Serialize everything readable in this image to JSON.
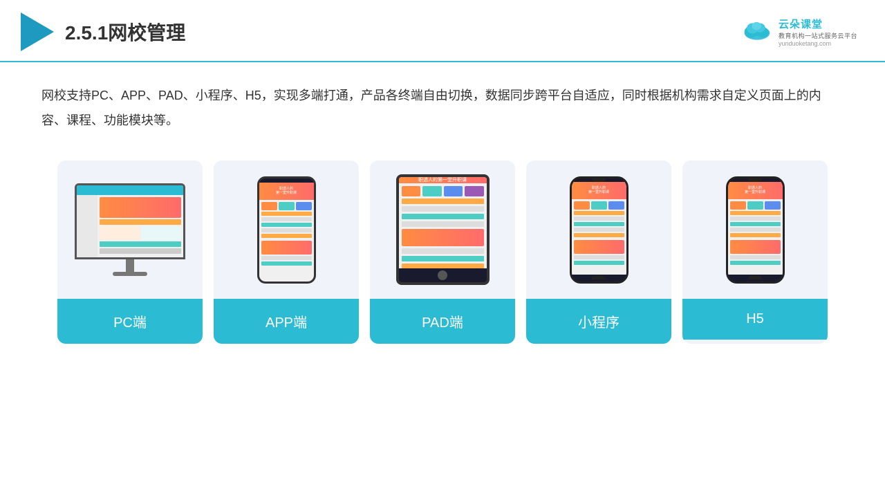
{
  "header": {
    "title": "2.5.1网校管理",
    "logo": {
      "main_text": "云朵课堂",
      "sub_text": "教育机构一站式服务云平台",
      "domain": "yunduoketang.com"
    }
  },
  "description": {
    "text": "网校支持PC、APP、PAD、小程序、H5，实现多端打通，产品各终端自由切换，数据同步跨平台自适应，同时根据机构需求自定义页面上的内容、课程、功能模块等。"
  },
  "cards": [
    {
      "label": "PC端",
      "type": "pc"
    },
    {
      "label": "APP端",
      "type": "phone"
    },
    {
      "label": "PAD端",
      "type": "tablet"
    },
    {
      "label": "小程序",
      "type": "phone2"
    },
    {
      "label": "H5",
      "type": "phone3"
    }
  ]
}
